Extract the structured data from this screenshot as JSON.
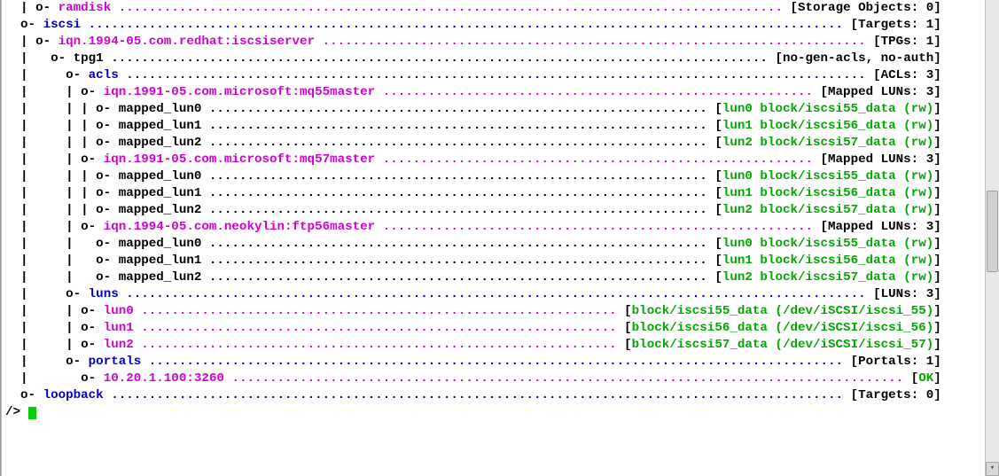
{
  "width_chars": 124,
  "lines": [
    {
      "indent": "  | ",
      "bullet": true,
      "label": "ramdisk",
      "label_color": "magenta",
      "dot_color": "magenta",
      "right": "[Storage Objects: 0]",
      "right_color": "black"
    },
    {
      "indent": "  ",
      "bullet": true,
      "label": "iscsi",
      "label_color": "blue",
      "dot_color": "blue",
      "right": "[Targets: 1]",
      "right_color": "black"
    },
    {
      "indent": "  | ",
      "bullet": true,
      "label": "iqn.1994-05.com.redhat:iscsiserver",
      "label_color": "magenta",
      "dot_color": "magenta",
      "right": "[TPGs: 1]",
      "right_color": "black"
    },
    {
      "indent": "  |   ",
      "bullet": true,
      "label": "tpg1",
      "label_color": "black",
      "dot_color": "black",
      "right": "[no-gen-acls, no-auth]",
      "right_color": "black"
    },
    {
      "indent": "  |     ",
      "bullet": true,
      "label": "acls",
      "label_color": "blue",
      "dot_color": "blue",
      "right": "[ACLs: 3]",
      "right_color": "black"
    },
    {
      "indent": "  |     | ",
      "bullet": true,
      "label": "iqn.1991-05.com.microsoft:mq55master",
      "label_color": "magenta",
      "dot_color": "magenta",
      "right": "[Mapped LUNs: 3]",
      "right_color": "black"
    },
    {
      "indent": "  |     | | ",
      "bullet": true,
      "label": "mapped_lun0",
      "label_color": "black",
      "dot_color": "black",
      "right_segments": [
        {
          "t": "[",
          "c": "black"
        },
        {
          "t": "lun0 block/iscsi55_data (rw)",
          "c": "green"
        },
        {
          "t": "]",
          "c": "black"
        }
      ]
    },
    {
      "indent": "  |     | | ",
      "bullet": true,
      "label": "mapped_lun1",
      "label_color": "black",
      "dot_color": "black",
      "right_segments": [
        {
          "t": "[",
          "c": "black"
        },
        {
          "t": "lun1 block/iscsi56_data (rw)",
          "c": "green"
        },
        {
          "t": "]",
          "c": "black"
        }
      ]
    },
    {
      "indent": "  |     | | ",
      "bullet": true,
      "label": "mapped_lun2",
      "label_color": "black",
      "dot_color": "black",
      "right_segments": [
        {
          "t": "[",
          "c": "black"
        },
        {
          "t": "lun2 block/iscsi57_data (rw)",
          "c": "green"
        },
        {
          "t": "]",
          "c": "black"
        }
      ]
    },
    {
      "indent": "  |     | ",
      "bullet": true,
      "label": "iqn.1991-05.com.microsoft:mq57master",
      "label_color": "magenta",
      "dot_color": "magenta",
      "right": "[Mapped LUNs: 3]",
      "right_color": "black"
    },
    {
      "indent": "  |     | | ",
      "bullet": true,
      "label": "mapped_lun0",
      "label_color": "black",
      "dot_color": "black",
      "right_segments": [
        {
          "t": "[",
          "c": "black"
        },
        {
          "t": "lun0 block/iscsi55_data (rw)",
          "c": "green"
        },
        {
          "t": "]",
          "c": "black"
        }
      ]
    },
    {
      "indent": "  |     | | ",
      "bullet": true,
      "label": "mapped_lun1",
      "label_color": "black",
      "dot_color": "black",
      "right_segments": [
        {
          "t": "[",
          "c": "black"
        },
        {
          "t": "lun1 block/iscsi56_data (rw)",
          "c": "green"
        },
        {
          "t": "]",
          "c": "black"
        }
      ]
    },
    {
      "indent": "  |     | | ",
      "bullet": true,
      "label": "mapped_lun2",
      "label_color": "black",
      "dot_color": "black",
      "right_segments": [
        {
          "t": "[",
          "c": "black"
        },
        {
          "t": "lun2 block/iscsi57_data (rw)",
          "c": "green"
        },
        {
          "t": "]",
          "c": "black"
        }
      ]
    },
    {
      "indent": "  |     | ",
      "bullet": true,
      "label": "iqn.1994-05.com.neokylin:ftp56master",
      "label_color": "magenta",
      "dot_color": "magenta",
      "right": "[Mapped LUNs: 3]",
      "right_color": "black"
    },
    {
      "indent": "  |     |   ",
      "bullet": true,
      "label": "mapped_lun0",
      "label_color": "black",
      "dot_color": "black",
      "right_segments": [
        {
          "t": "[",
          "c": "black"
        },
        {
          "t": "lun0 block/iscsi55_data (rw)",
          "c": "green"
        },
        {
          "t": "]",
          "c": "black"
        }
      ]
    },
    {
      "indent": "  |     |   ",
      "bullet": true,
      "label": "mapped_lun1",
      "label_color": "black",
      "dot_color": "black",
      "right_segments": [
        {
          "t": "[",
          "c": "black"
        },
        {
          "t": "lun1 block/iscsi56_data (rw)",
          "c": "green"
        },
        {
          "t": "]",
          "c": "black"
        }
      ]
    },
    {
      "indent": "  |     |   ",
      "bullet": true,
      "label": "mapped_lun2",
      "label_color": "black",
      "dot_color": "black",
      "right_segments": [
        {
          "t": "[",
          "c": "black"
        },
        {
          "t": "lun2 block/iscsi57_data (rw)",
          "c": "green"
        },
        {
          "t": "]",
          "c": "black"
        }
      ]
    },
    {
      "indent": "  |     ",
      "bullet": true,
      "label": "luns",
      "label_color": "blue",
      "dot_color": "blue",
      "right": "[LUNs: 3]",
      "right_color": "black"
    },
    {
      "indent": "  |     | ",
      "bullet": true,
      "label": "lun0",
      "label_color": "magenta",
      "dot_color": "magenta",
      "right_segments": [
        {
          "t": "[",
          "c": "black"
        },
        {
          "t": "block/iscsi55_data (/dev/iSCSI/iscsi_55)",
          "c": "green"
        },
        {
          "t": "]",
          "c": "black"
        }
      ]
    },
    {
      "indent": "  |     | ",
      "bullet": true,
      "label": "lun1",
      "label_color": "magenta",
      "dot_color": "magenta",
      "right_segments": [
        {
          "t": "[",
          "c": "black"
        },
        {
          "t": "block/iscsi56_data (/dev/iSCSI/iscsi_56)",
          "c": "green"
        },
        {
          "t": "]",
          "c": "black"
        }
      ]
    },
    {
      "indent": "  |     | ",
      "bullet": true,
      "label": "lun2",
      "label_color": "magenta",
      "dot_color": "magenta",
      "right_segments": [
        {
          "t": "[",
          "c": "black"
        },
        {
          "t": "block/iscsi57_data (/dev/iSCSI/iscsi_57)",
          "c": "green"
        },
        {
          "t": "]",
          "c": "black"
        }
      ]
    },
    {
      "indent": "  |     ",
      "bullet": true,
      "label": "portals",
      "label_color": "blue",
      "dot_color": "blue",
      "right": "[Portals: 1]",
      "right_color": "black"
    },
    {
      "indent": "  |       ",
      "bullet": true,
      "label": "10.20.1.100:3260",
      "label_color": "magenta",
      "dot_color": "magenta",
      "right_segments": [
        {
          "t": "[",
          "c": "black"
        },
        {
          "t": "OK",
          "c": "green"
        },
        {
          "t": "]",
          "c": "black"
        }
      ]
    },
    {
      "indent": "  ",
      "bullet": true,
      "label": "loopback",
      "label_color": "blue",
      "dot_color": "blue",
      "right": "[Targets: 0]",
      "right_color": "black"
    }
  ],
  "prompt": "/> ",
  "bullet_text": "o- "
}
